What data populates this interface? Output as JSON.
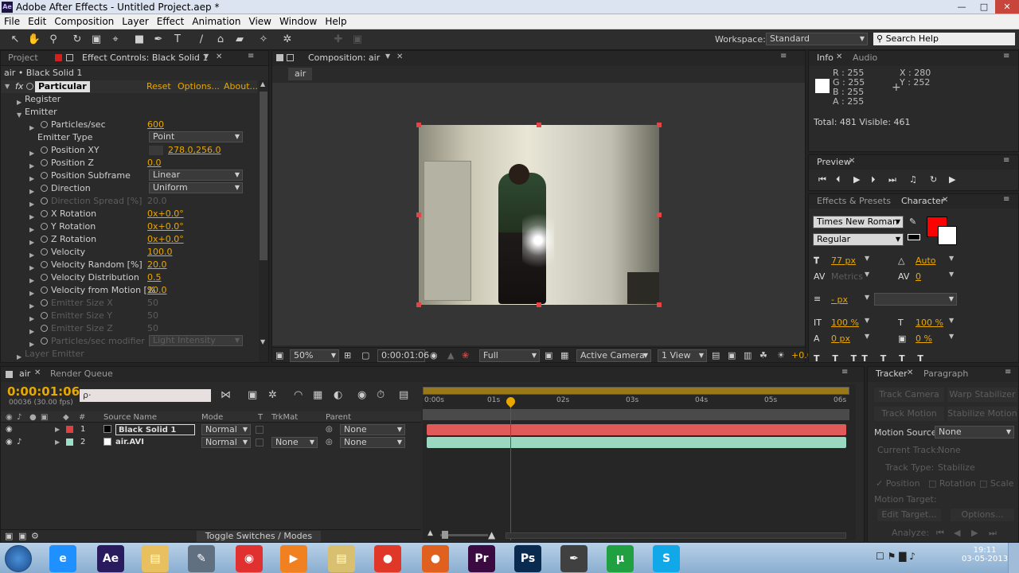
{
  "window": {
    "title": "Adobe After Effects - Untitled Project.aep *",
    "icon_text": "Ae",
    "min": "—",
    "max": "□",
    "close": "✕"
  },
  "menu": [
    "File",
    "Edit",
    "Composition",
    "Layer",
    "Effect",
    "Animation",
    "View",
    "Window",
    "Help"
  ],
  "workspace": {
    "label": "Workspace:",
    "value": "Standard",
    "search": "Search Help"
  },
  "project_panel": {
    "tab_project": "Project",
    "tab_effect": "Effect Controls: Black Solid 1",
    "layer_path": "air • Black Solid 1",
    "effect": {
      "name": "Particular",
      "reset": "Reset",
      "options": "Options...",
      "about": "About..."
    },
    "rows": [
      {
        "label": "Register",
        "indent": 1,
        "type": "group"
      },
      {
        "label": "Emitter",
        "indent": 1,
        "type": "group_open"
      },
      {
        "label": "Particles/sec",
        "value": "600",
        "indent": 2
      },
      {
        "label": "Emitter Type",
        "value": "Point",
        "indent": 2,
        "dropdown": true
      },
      {
        "label": "Position XY",
        "value": "278.0,256.0",
        "indent": 2,
        "target": true
      },
      {
        "label": "Position Z",
        "value": "0.0",
        "indent": 2
      },
      {
        "label": "Position Subframe",
        "value": "Linear",
        "indent": 2,
        "dropdown": true
      },
      {
        "label": "Direction",
        "value": "Uniform",
        "indent": 2,
        "dropdown": true
      },
      {
        "label": "Direction Spread [%]",
        "value": "20.0",
        "indent": 2,
        "dim": true
      },
      {
        "label": "X Rotation",
        "value": "0x+0.0°",
        "indent": 2
      },
      {
        "label": "Y Rotation",
        "value": "0x+0.0°",
        "indent": 2
      },
      {
        "label": "Z Rotation",
        "value": "0x+0.0°",
        "indent": 2
      },
      {
        "label": "Velocity",
        "value": "100.0",
        "indent": 2
      },
      {
        "label": "Velocity Random [%]",
        "value": "20.0",
        "indent": 2
      },
      {
        "label": "Velocity Distribution",
        "value": "0.5",
        "indent": 2
      },
      {
        "label": "Velocity from Motion [%",
        "value": "20.0",
        "indent": 2
      },
      {
        "label": "Emitter Size X",
        "value": "50",
        "indent": 2,
        "dim": true
      },
      {
        "label": "Emitter Size Y",
        "value": "50",
        "indent": 2,
        "dim": true
      },
      {
        "label": "Emitter Size Z",
        "value": "50",
        "indent": 2,
        "dim": true
      },
      {
        "label": "Particles/sec modifier",
        "value": "Light Intensity",
        "indent": 2,
        "dim": true,
        "dropdown": true
      },
      {
        "label": "Layer Emitter",
        "indent": 1,
        "type": "group",
        "dim": true
      }
    ]
  },
  "comp_panel": {
    "tab": "Composition: air",
    "crumb": "air",
    "zoom": "50%",
    "timecode": "0:00:01:06",
    "resolution": "Full",
    "camera": "Active Camera",
    "view": "1 View",
    "offset": "+0.0"
  },
  "info_panel": {
    "tab_info": "Info",
    "tab_audio": "Audio",
    "r": "R : 255",
    "g": "G : 255",
    "b": "B : 255",
    "a": "A : 255",
    "x": "X : 280",
    "y": "Y : 252",
    "totals": "Total: 481  Visible: 461"
  },
  "preview_panel": {
    "tab": "Preview"
  },
  "character_panel": {
    "tab_effects": "Effects & Presets",
    "tab_char": "Character",
    "font": "Times New Roman",
    "style": "Regular",
    "size": "77 px",
    "leading": "Auto",
    "kerning": "Metrics",
    "tracking": "0",
    "stroke": "- px",
    "vscale": "100 %",
    "hscale": "100 %",
    "baseline": "0 px",
    "tsume": "0 %",
    "fill_color": "#ff0000"
  },
  "timeline": {
    "tab_comp": "air",
    "tab_rq": "Render Queue",
    "timecode": "0:00:01:06",
    "fps": "00036 (30.00 fps)",
    "search_placeholder": "ρ·",
    "cols": {
      "num": "#",
      "source": "Source Name",
      "mode": "Mode",
      "t": "T",
      "trkmat": "TrkMat",
      "parent": "Parent"
    },
    "ruler": [
      "0:00s",
      "01s",
      "02s",
      "03s",
      "04s",
      "05s",
      "06s"
    ],
    "layers": [
      {
        "num": "1",
        "name": "Black Solid 1",
        "mode": "Normal",
        "trkmat": "",
        "parent": "None",
        "color": "#e04040"
      },
      {
        "num": "2",
        "name": "air.AVI",
        "mode": "Normal",
        "trkmat": "None",
        "parent": "None",
        "color": "#9de0c8"
      }
    ],
    "toggle": "Toggle Switches / Modes"
  },
  "tracker": {
    "tab_tracker": "Tracker",
    "tab_para": "Paragraph",
    "track_camera": "Track Camera",
    "warp": "Warp Stabilizer",
    "track_motion": "Track Motion",
    "stabilize": "Stabilize Motion",
    "motion_source_label": "Motion Source:",
    "motion_source": "None",
    "current_track": "Current Track:",
    "current_track_val": "None",
    "track_type": "Track Type:",
    "track_type_val": "Stabilize",
    "position": "Position",
    "rotation": "Rotation",
    "scale": "Scale",
    "motion_target": "Motion Target:",
    "edit_target": "Edit Target...",
    "options": "Options...",
    "analyze": "Analyze:"
  },
  "taskbar": {
    "time": "19:11",
    "date": "03-05-2013",
    "apps": [
      {
        "name": "ie",
        "label": "e",
        "color": "#1e90ff"
      },
      {
        "name": "after-effects",
        "label": "Ae",
        "color": "#2a1a5e"
      },
      {
        "name": "explorer",
        "label": "▤",
        "color": "#e8c060"
      },
      {
        "name": "notepad",
        "label": "✎",
        "color": "#607080"
      },
      {
        "name": "chrome",
        "label": "◉",
        "color": "#e03030"
      },
      {
        "name": "media-player",
        "label": "▶",
        "color": "#f08020"
      },
      {
        "name": "folder",
        "label": "▤",
        "color": "#d8c070"
      },
      {
        "name": "flash",
        "label": "●",
        "color": "#e03828"
      },
      {
        "name": "firefox",
        "label": "●",
        "color": "#e06020"
      },
      {
        "name": "premiere",
        "label": "Pr",
        "color": "#3a0a40"
      },
      {
        "name": "photoshop",
        "label": "Ps",
        "color": "#0a2a50"
      },
      {
        "name": "inkscape",
        "label": "✒",
        "color": "#404040"
      },
      {
        "name": "utorrent",
        "label": "μ",
        "color": "#20a040"
      },
      {
        "name": "skype",
        "label": "S",
        "color": "#10a8e8"
      }
    ]
  }
}
